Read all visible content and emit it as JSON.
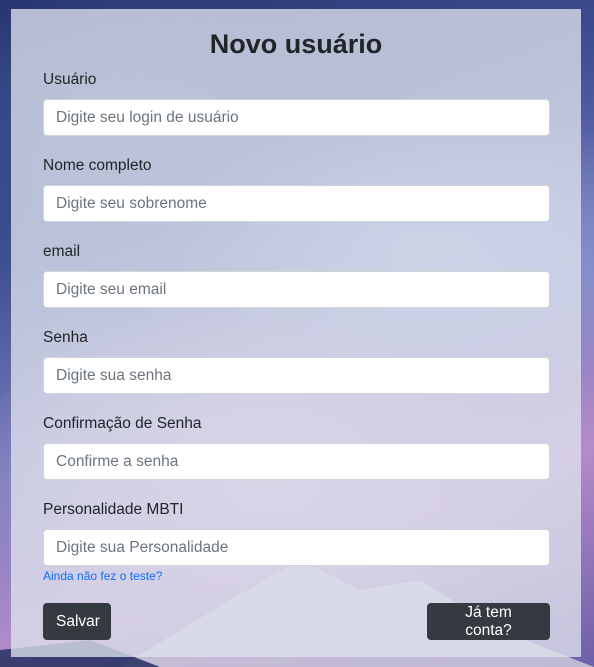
{
  "form": {
    "title": "Novo usuário",
    "fields": [
      {
        "label": "Usuário",
        "placeholder": "Digite seu login de usuário",
        "value": ""
      },
      {
        "label": "Nome completo",
        "placeholder": "Digite seu sobrenome",
        "value": ""
      },
      {
        "label": "email",
        "placeholder": "Digite seu email",
        "value": ""
      },
      {
        "label": "Senha",
        "placeholder": "Digite sua senha",
        "value": ""
      },
      {
        "label": "Confirmação de Senha",
        "placeholder": "Confirme a senha",
        "value": ""
      },
      {
        "label": "Personalidade MBTI",
        "placeholder": "Digite sua Personalidade",
        "value": ""
      }
    ],
    "mbti_test_link": "Ainda não fez o teste?",
    "save_button": "Salvar",
    "login_button": "Já tem conta?"
  },
  "colors": {
    "panel_background": "#dee2ec",
    "button_background": "#343a40",
    "link_color": "#0d6efd",
    "text_color": "#212529"
  }
}
